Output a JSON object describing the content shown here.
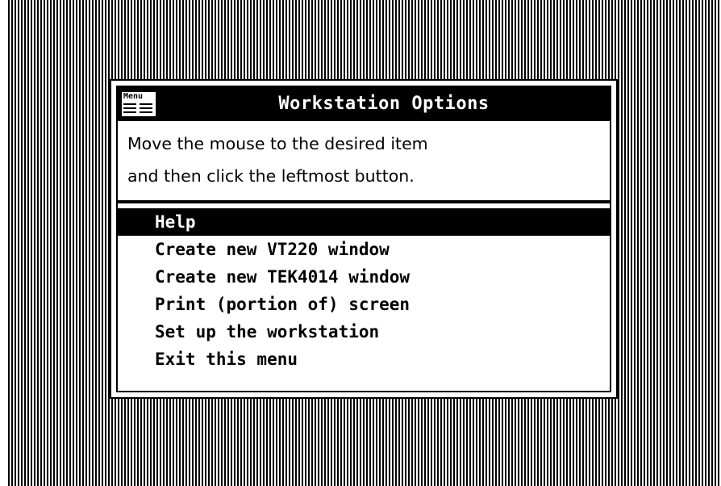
{
  "window": {
    "title": "Workstation Options",
    "icon_label": "Menu",
    "icon": "menu-icon"
  },
  "instructions": {
    "line1": "Move the mouse to the desired item",
    "line2": "and then click the leftmost button."
  },
  "menu": {
    "selected_index": 0,
    "items": [
      {
        "label": "Help"
      },
      {
        "label": "Create new VT220 window"
      },
      {
        "label": "Create new TEK4014 window"
      },
      {
        "label": "Print (portion of) screen"
      },
      {
        "label": "Set up the workstation"
      },
      {
        "label": "Exit this menu"
      }
    ]
  }
}
